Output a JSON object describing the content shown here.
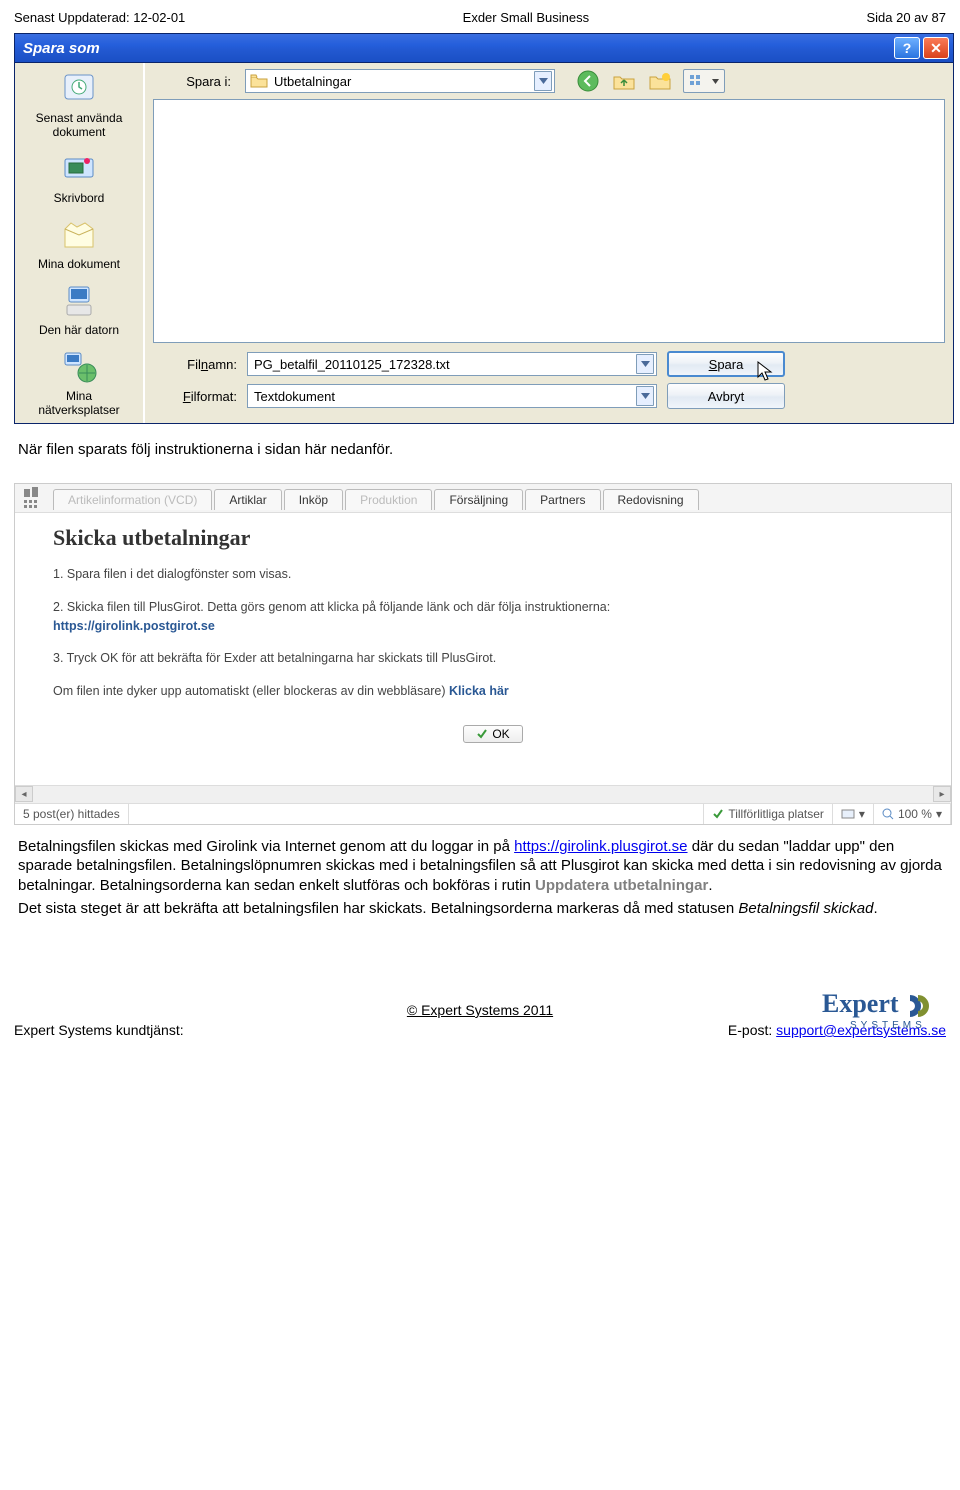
{
  "header": {
    "left": "Senast Uppdaterad: 12-02-01",
    "center": "Exder Small Business",
    "right": "Sida 20 av 87"
  },
  "dialog": {
    "title": "Spara som",
    "look_in_label": "Spara i:",
    "look_in_value": "Utbetalningar",
    "sidebar": [
      {
        "label": "Senast använda\ndokument"
      },
      {
        "label": "Skrivbord"
      },
      {
        "label": "Mina dokument"
      },
      {
        "label": "Den här datorn"
      },
      {
        "label": "Mina\nnätverksplatser"
      }
    ],
    "filename_label": "Fil",
    "filename_label_u": "n",
    "filename_label_rest": "amn:",
    "filename_value": "PG_betalfil_20110125_172328.txt",
    "fileformat_label_u": "F",
    "fileformat_label_rest": "ilformat:",
    "fileformat_value": "Textdokument",
    "save_label_u": "S",
    "save_label_rest": "para",
    "cancel_label_dash": "Avbryt"
  },
  "text1": "När filen sparats följ instruktionerna i sidan här nedanför.",
  "webapp": {
    "tabs": [
      "Artikelinformation (VCD)",
      "Artiklar",
      "Inköp",
      "Produktion",
      "Försäljning",
      "Partners",
      "Redovisning"
    ],
    "heading": "Skicka utbetalningar",
    "step1": "1. Spara filen i det dialogfönster som visas.",
    "step2a": "2. Skicka filen till PlusGirot. Detta görs genom att klicka på följande länk och där följa instruktionerna:",
    "step2link": "https://girolink.postgirot.se",
    "step3": "3. Tryck OK för att bekräfta för Exder att betalningarna har skickats till PlusGirot.",
    "step4a": "Om filen inte dyker upp automatiskt (eller blockeras av din webbläsare) ",
    "step4b": "Klicka här",
    "ok_label": "OK",
    "status_left": "5 post(er) hittades",
    "status_mid": "Tillförlitliga platser",
    "status_zoom": "100 %"
  },
  "paragraph2": {
    "p1a": "Betalningsfilen skickas med Girolink via Internet genom att du loggar in på ",
    "p1link": "https://girolink.plusgirot.se",
    "p1b": " där du sedan \"laddar upp\" den sparade betalningsfilen. Betalningslöpnumren skickas med i betalningsfilen så att Plusgirot kan skicka med detta i sin redovisning av gjorda betalningar. Betalningsorderna kan sedan enkelt slutföras och bokföras i rutin ",
    "p1c": "Uppdatera utbetalningar",
    "p1d": ".",
    "p2a": "Det sista steget är att bekräfta att betalningsfilen har skickats. Betalningsorderna markeras då med statusen ",
    "p2b": "Betalningsfil skickad",
    "p2c": "."
  },
  "footer": {
    "copyright": "© Expert Systems 2011",
    "left": "Expert Systems kundtjänst:",
    "email_label": "E-post: ",
    "email": "support@expertsystems.se",
    "logo_top": "Expert",
    "logo_sub": "SYSTEMS"
  }
}
